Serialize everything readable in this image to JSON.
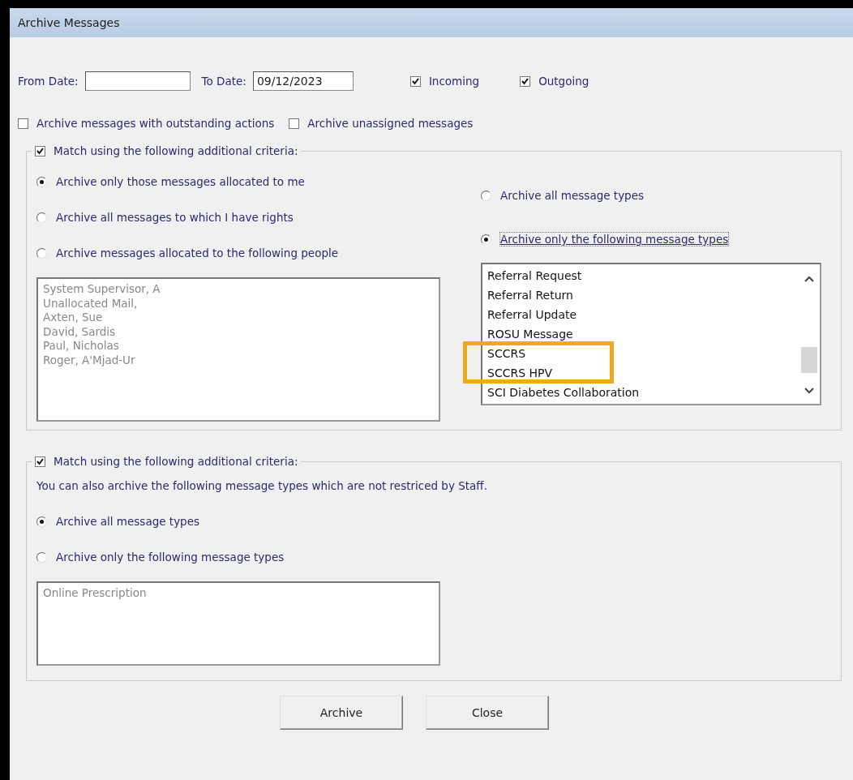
{
  "window": {
    "title": "Archive Messages"
  },
  "date_row": {
    "from_label": "From Date:",
    "to_label": "To Date:",
    "to_value": "09/12/2023",
    "checks": [
      {
        "label": "Incoming",
        "checked": true
      },
      {
        "label": "Outgoing",
        "checked": true
      }
    ]
  },
  "options": [
    {
      "label": "Archive messages with outstanding actions",
      "checked": false
    },
    {
      "label": "Archive unassigned messages",
      "checked": false
    }
  ],
  "staff_group": {
    "legend": "Match using the following additional criteria:",
    "checked": true,
    "people_radios": [
      {
        "label": "Archive only those messages allocated to me",
        "selected": true
      },
      {
        "label": "Archive all messages to which I have rights",
        "selected": false
      },
      {
        "label": "Archive messages allocated to the following people",
        "selected": false
      }
    ],
    "people": [
      "System Supervisor, A",
      "Unallocated Mail,",
      "Axten, Sue",
      "David, Sardis",
      "Paul, Nicholas",
      "Roger, A'Mjad-Ur"
    ],
    "type_radios": [
      {
        "label": "Archive all message types",
        "selected": false
      },
      {
        "label": "Archive only the following message types",
        "selected": true
      }
    ],
    "types": [
      "Referral Request",
      "Referral Return",
      "Referral Update",
      "ROSU Message",
      "SCCRS",
      "SCCRS HPV",
      "SCI Diabetes Collaboration"
    ]
  },
  "other_group": {
    "legend": "Match using the following additional criteria:",
    "checked": true,
    "note": "You can also archive the following message types which are not restriced by Staff.",
    "radios": [
      {
        "label": "Archive all message types",
        "selected": true
      },
      {
        "label": "Archive only the following message types",
        "selected": false
      }
    ],
    "types": [
      "Online Prescription"
    ]
  },
  "buttons": [
    "Archive",
    "Close"
  ]
}
